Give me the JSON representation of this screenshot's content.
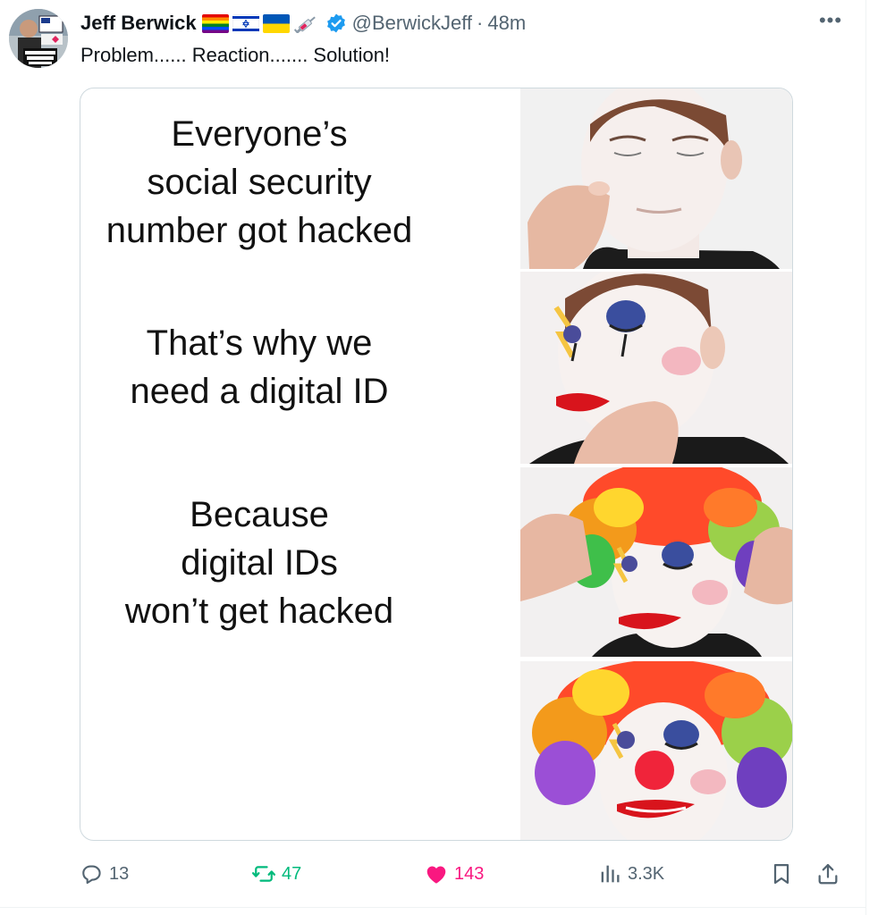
{
  "tweet": {
    "author_name": "Jeff Berwick",
    "handle": "@BerwickJeff",
    "separator": "·",
    "time": "48m",
    "more_label": "•••",
    "text": "Problem...... Reaction....... Solution!",
    "flag_icons": [
      "rainbow-flag-icon",
      "israel-flag-icon",
      "ukraine-flag-icon",
      "syringe-icon"
    ],
    "verified_color": "#1d9bf0"
  },
  "meme": {
    "panels": [
      {
        "lines": [
          "Everyone’s",
          "social security",
          "number got hacked"
        ]
      },
      {
        "lines": [
          "That’s why we",
          "need a digital ID"
        ]
      },
      {
        "lines": [
          "Because",
          "digital IDs",
          "won’t get hacked"
        ]
      }
    ]
  },
  "actions": {
    "replies": "13",
    "reposts": "47",
    "likes": "143",
    "views": "3.3K",
    "repost_color": "#00ba7c",
    "like_color": "#f91880",
    "muted_color": "#536471"
  }
}
